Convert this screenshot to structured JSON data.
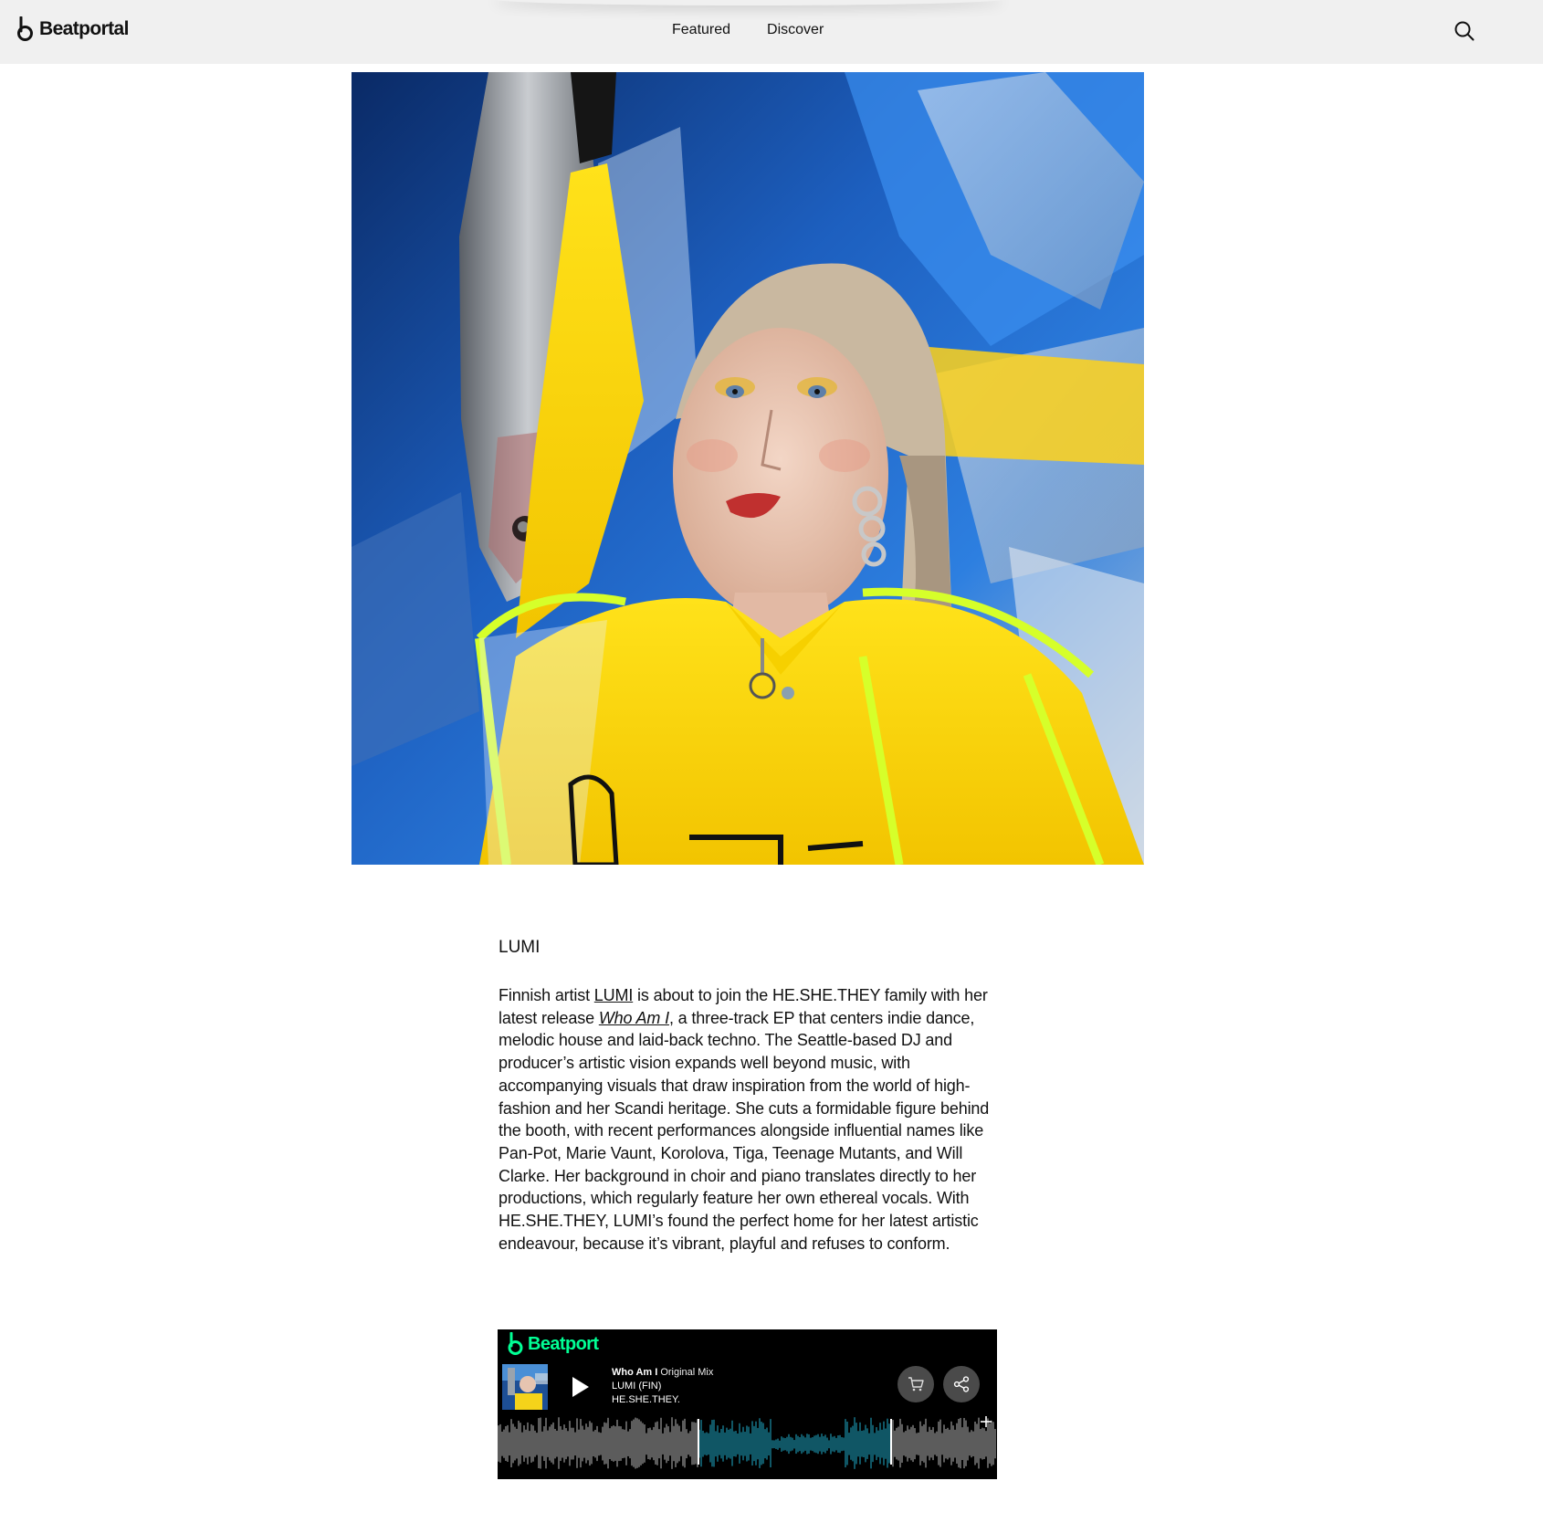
{
  "header": {
    "brand": "Beatportal",
    "nav": [
      "Featured",
      "Discover"
    ],
    "search_icon": "search-icon"
  },
  "hero": {
    "icon": "hero-photo"
  },
  "article": {
    "caption": "LUMI",
    "p1_a": "Finnish artist ",
    "link_lumi": "LUMI",
    "p1_b": " is about to join the HE.SHE.THEY family with her latest release ",
    "link_release": "Who Am I",
    "p1_c": ", a three-track EP that centers indie dance, melodic house and laid-back techno. The Seattle-based DJ and producer’s artistic vision expands well beyond music, with accompanying visuals that draw inspiration from the world of high-fashion and her Scandi heritage. She cuts a formidable figure behind the booth, with recent performances alongside influential names like Pan-Pot, Marie Vaunt, Korolova, Tiga, Teenage Mutants, and Will Clarke. Her background in choir and piano translates directly to her productions, which regularly feature her own ethereal vocals. With HE.SHE.THEY, LUMI’s found the perfect home for her latest artistic endeavour, because it’s vibrant, playful and refuses to conform."
  },
  "player": {
    "brand": "Beatport",
    "brand_color": "#01ff95",
    "track_title": "Who Am I",
    "mix": "Original Mix",
    "artist": "LUMI (FIN)",
    "label": "HE.SHE.THEY.",
    "waveform_color": "#9a9a9a",
    "waveform_highlight": "#1a8fa8",
    "icons": [
      "play-icon",
      "cart-icon",
      "share-icon",
      "plus-icon"
    ]
  }
}
